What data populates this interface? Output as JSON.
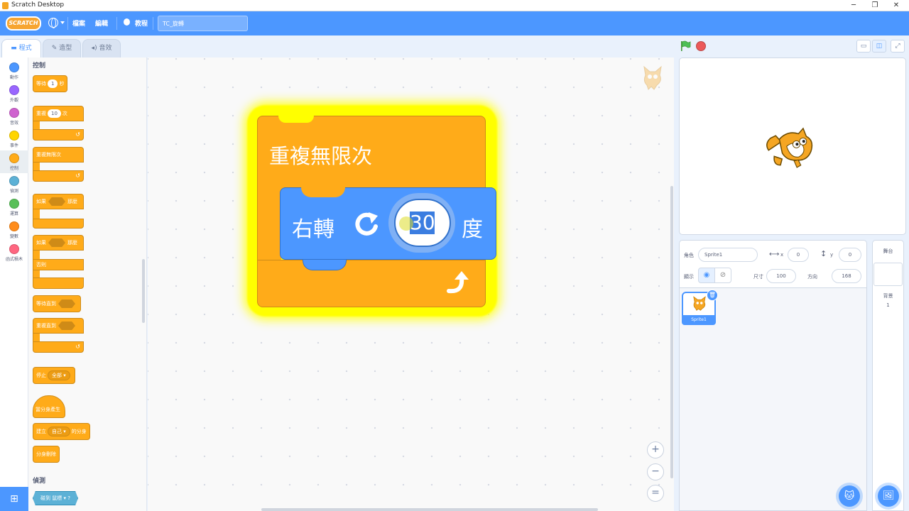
{
  "window": {
    "title": "Scratch Desktop",
    "minimize": "─",
    "maximize": "❐",
    "close": "✕"
  },
  "menubar": {
    "logo": "SCRATCH",
    "file": "檔案",
    "edit": "編輯",
    "tutorials": "教程",
    "project_name": "TC_旋轉"
  },
  "tabs": {
    "code": "程式",
    "costumes": "造型",
    "sounds": "音效"
  },
  "categories": [
    {
      "label": "動作",
      "color": "#4c97ff"
    },
    {
      "label": "外觀",
      "color": "#9966ff"
    },
    {
      "label": "音效",
      "color": "#cf63cf"
    },
    {
      "label": "事件",
      "color": "#ffd500"
    },
    {
      "label": "控制",
      "color": "#ffab19"
    },
    {
      "label": "偵測",
      "color": "#5cb1d6"
    },
    {
      "label": "運算",
      "color": "#59c059"
    },
    {
      "label": "變數",
      "color": "#ff8c1a"
    },
    {
      "label": "函式積木",
      "color": "#ff6680"
    }
  ],
  "palette": {
    "section_control": "控制",
    "wait_pre": "等待",
    "wait_val": "1",
    "wait_post": "秒",
    "repeat_pre": "重複",
    "repeat_val": "10",
    "repeat_post": "次",
    "forever": "重複無限次",
    "if_pre": "如果",
    "if_post": "那麼",
    "ifelse_pre": "如果",
    "ifelse_post": "那麼",
    "else": "否則",
    "wait_until": "等待直到",
    "repeat_until": "重複直到",
    "stop": "停止",
    "stop_opt": "全部 ▾",
    "clone_hat": "當分身產生",
    "create_clone_pre": "建立",
    "create_clone_opt": "自己 ▾",
    "create_clone_post": "的分身",
    "delete_clone": "分身刪除",
    "section_sensing": "偵測",
    "touching": "碰到",
    "touching_opt": "鼠標 ▾",
    "touching_q": "?"
  },
  "script": {
    "forever_label": "重複無限次",
    "turn_label": "右轉",
    "turn_value": "30",
    "degree_label": "度"
  },
  "zoom": {
    "in": "+",
    "out": "−",
    "reset": "="
  },
  "sprite_info": {
    "sprite_label": "角色",
    "sprite_name": "Sprite1",
    "x_label": "x",
    "x_value": "0",
    "y_label": "y",
    "y_value": "0",
    "show_label": "顯示",
    "size_label": "尺寸",
    "size_value": "100",
    "direction_label": "方向",
    "direction_value": "168"
  },
  "sprites": [
    {
      "name": "Sprite1"
    }
  ],
  "stage_panel": {
    "title": "舞台",
    "backdrops_label": "背景",
    "backdrops_count": "1"
  },
  "colors": {
    "accent": "#4c97ff",
    "control": "#ffab19",
    "glow": "#ffff00"
  }
}
